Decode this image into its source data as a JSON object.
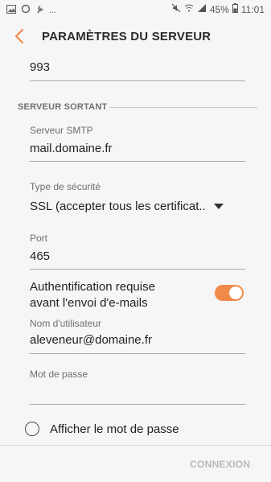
{
  "status_bar": {
    "notification_icons": [
      "image-icon",
      "circle-sync-icon",
      "wrench-icon"
    ],
    "more": "...",
    "battery": "45%",
    "time": "11:01"
  },
  "header": {
    "title": "PARAMÈTRES DU SERVEUR"
  },
  "fields": {
    "incoming_port_value": "993",
    "section_title": "SERVEUR SORTANT",
    "smtp_label": "Serveur SMTP",
    "smtp_value": "mail.domaine.fr",
    "security_label": "Type de sécurité",
    "security_value": "SSL (accepter tous les certificat..",
    "port_label": "Port",
    "port_value": "465",
    "auth_line1": "Authentification requise",
    "auth_line2": "avant l'envoi d'e-mails",
    "auth_enabled": true,
    "username_label": "Nom d'utilisateur",
    "username_value": "aleveneur@domaine.fr",
    "password_label": "Mot de passe",
    "password_value": "",
    "show_password_label": "Afficher le mot de passe",
    "show_password_checked": false
  },
  "footer": {
    "connect_label": "CONNEXION"
  },
  "colors": {
    "accent": "#f08a4b",
    "background": "#f6f6f6"
  }
}
